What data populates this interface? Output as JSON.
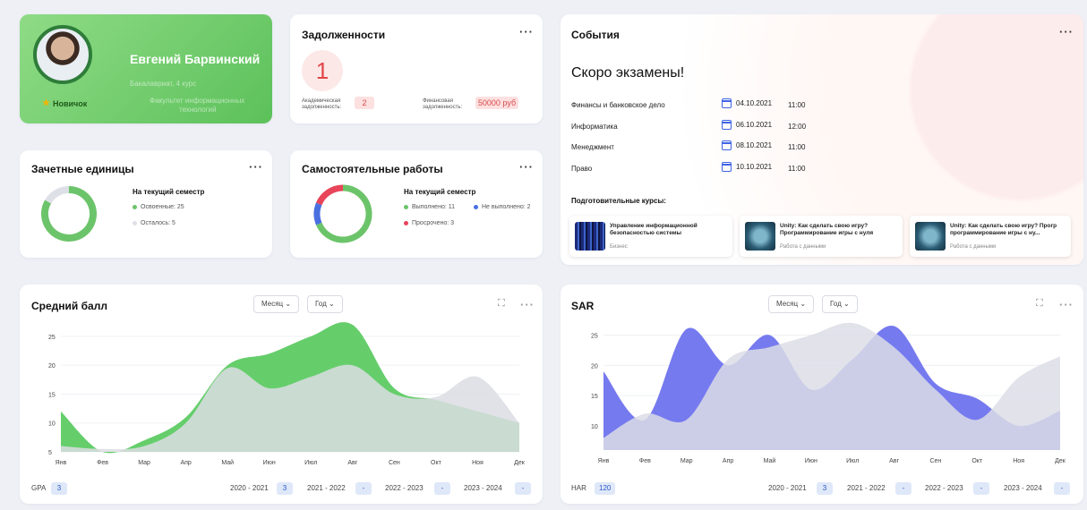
{
  "profile": {
    "name": "Евгений Барвинский",
    "line1": "Бакалавриат, 4 курс",
    "line2": "Факультет информационных",
    "line3": "технологий",
    "badge": "Новичок"
  },
  "debts": {
    "title": "Задолженности",
    "count": "1",
    "acad_label_1": "Академическая",
    "acad_label_2": "задолженность:",
    "acad_value": "2",
    "fin_label_1": "Финансовая",
    "fin_label_2": "задолженность:",
    "fin_value": "50000 руб"
  },
  "credits": {
    "title": "Зачетные единицы",
    "legend_title": "На текущий семестр",
    "items": [
      {
        "label": "Освоенные: 25",
        "color": "#6cc46a"
      },
      {
        "label": "Осталось: 5",
        "color": "#dde0e6"
      }
    ]
  },
  "works": {
    "title": "Самостоятельные работы",
    "legend_title": "На текущий семестр",
    "items": [
      {
        "label": "Выполнено: 11",
        "color": "#6cc46a"
      },
      {
        "label": "Не выполнено: 2",
        "color": "#4a6fe0"
      },
      {
        "label": "Просрочено: 3",
        "color": "#e8445a"
      }
    ]
  },
  "events": {
    "title": "События",
    "headline": "Скоро экзамены!",
    "exams": [
      {
        "name": "Финансы и банковское дело",
        "date": "04.10.2021",
        "time": "11:00"
      },
      {
        "name": "Информатика",
        "date": "06.10.2021",
        "time": "12:00"
      },
      {
        "name": "Менеджмент",
        "date": "08.10.2021",
        "time": "11:00"
      },
      {
        "name": "Право",
        "date": "10.10.2021",
        "time": "11:00"
      }
    ],
    "courses_label": "Подготовительные курсы:",
    "courses": [
      {
        "title": "Управление информационной безопасностью системы",
        "tag": "Бизнес"
      },
      {
        "title": "Unity: Как сделать свою игру? Программирование игры с нуля",
        "tag": "Работа с данными"
      },
      {
        "title": "Unity: Как сделать свою игру? Прогр программирование игры с ну...",
        "tag": "Работа с данными"
      }
    ]
  },
  "gpa_card": {
    "title": "Средний балл",
    "month_select": "Месяц ⌄",
    "year_select": "Год ⌄",
    "footer_label": "GPA",
    "footer_value": "3",
    "years": [
      {
        "label": "2020 - 2021",
        "value": "3"
      },
      {
        "label": "2021 - 2022",
        "value": "-"
      },
      {
        "label": "2022 - 2023",
        "value": "-"
      },
      {
        "label": "2023 - 2024",
        "value": "-"
      }
    ]
  },
  "sar_card": {
    "title": "SAR",
    "month_select": "Месяц ⌄",
    "year_select": "Год ⌄",
    "footer_label": "HAR",
    "footer_value": "120",
    "years": [
      {
        "label": "2020 - 2021",
        "value": "3"
      },
      {
        "label": "2021 - 2022",
        "value": "-"
      },
      {
        "label": "2022 - 2023",
        "value": "-"
      },
      {
        "label": "2023 - 2024",
        "value": "-"
      }
    ]
  },
  "chart_data": [
    {
      "type": "donut",
      "values": [
        25,
        5
      ],
      "colors": [
        "#6cc46a",
        "#dde0e6"
      ]
    },
    {
      "type": "donut",
      "values": [
        11,
        2,
        3
      ],
      "colors": [
        "#6cc46a",
        "#4a6fe0",
        "#e8445a"
      ]
    },
    {
      "type": "area",
      "categories": [
        "Янв",
        "Фев",
        "Мар",
        "Апр",
        "Май",
        "Июн",
        "Июл",
        "Авг",
        "Сен",
        "Окт",
        "Ноя",
        "Дек"
      ],
      "yticks": [
        25,
        20,
        15,
        10,
        5
      ],
      "ylim": [
        5,
        27
      ],
      "series": [
        {
          "values": [
            12,
            5,
            7,
            11,
            20,
            22,
            25,
            27,
            16,
            14,
            12,
            10
          ],
          "color": "#5dcb63"
        },
        {
          "values": [
            6,
            5.5,
            6,
            10,
            19.5,
            16,
            18,
            20,
            15,
            14.5,
            18,
            10
          ],
          "color": "#dcdde3"
        }
      ],
      "grid": true
    },
    {
      "type": "area",
      "categories": [
        "Янв",
        "Фев",
        "Мар",
        "Апр",
        "Май",
        "Июн",
        "Июл",
        "Авг",
        "Сен",
        "Окт",
        "Ноя",
        "Дек"
      ],
      "yticks": [
        25,
        20,
        15,
        10
      ],
      "ylim": [
        6,
        27
      ],
      "series": [
        {
          "values": [
            19,
            11,
            26,
            20,
            25,
            16,
            21,
            26.5,
            17,
            14.5,
            10,
            12.5
          ],
          "color": "#6f73ee"
        },
        {
          "values": [
            8,
            12,
            11,
            21,
            23,
            25,
            27,
            23,
            16,
            11,
            18,
            21.5
          ],
          "color": "#dcdde6"
        }
      ],
      "grid": true
    }
  ]
}
